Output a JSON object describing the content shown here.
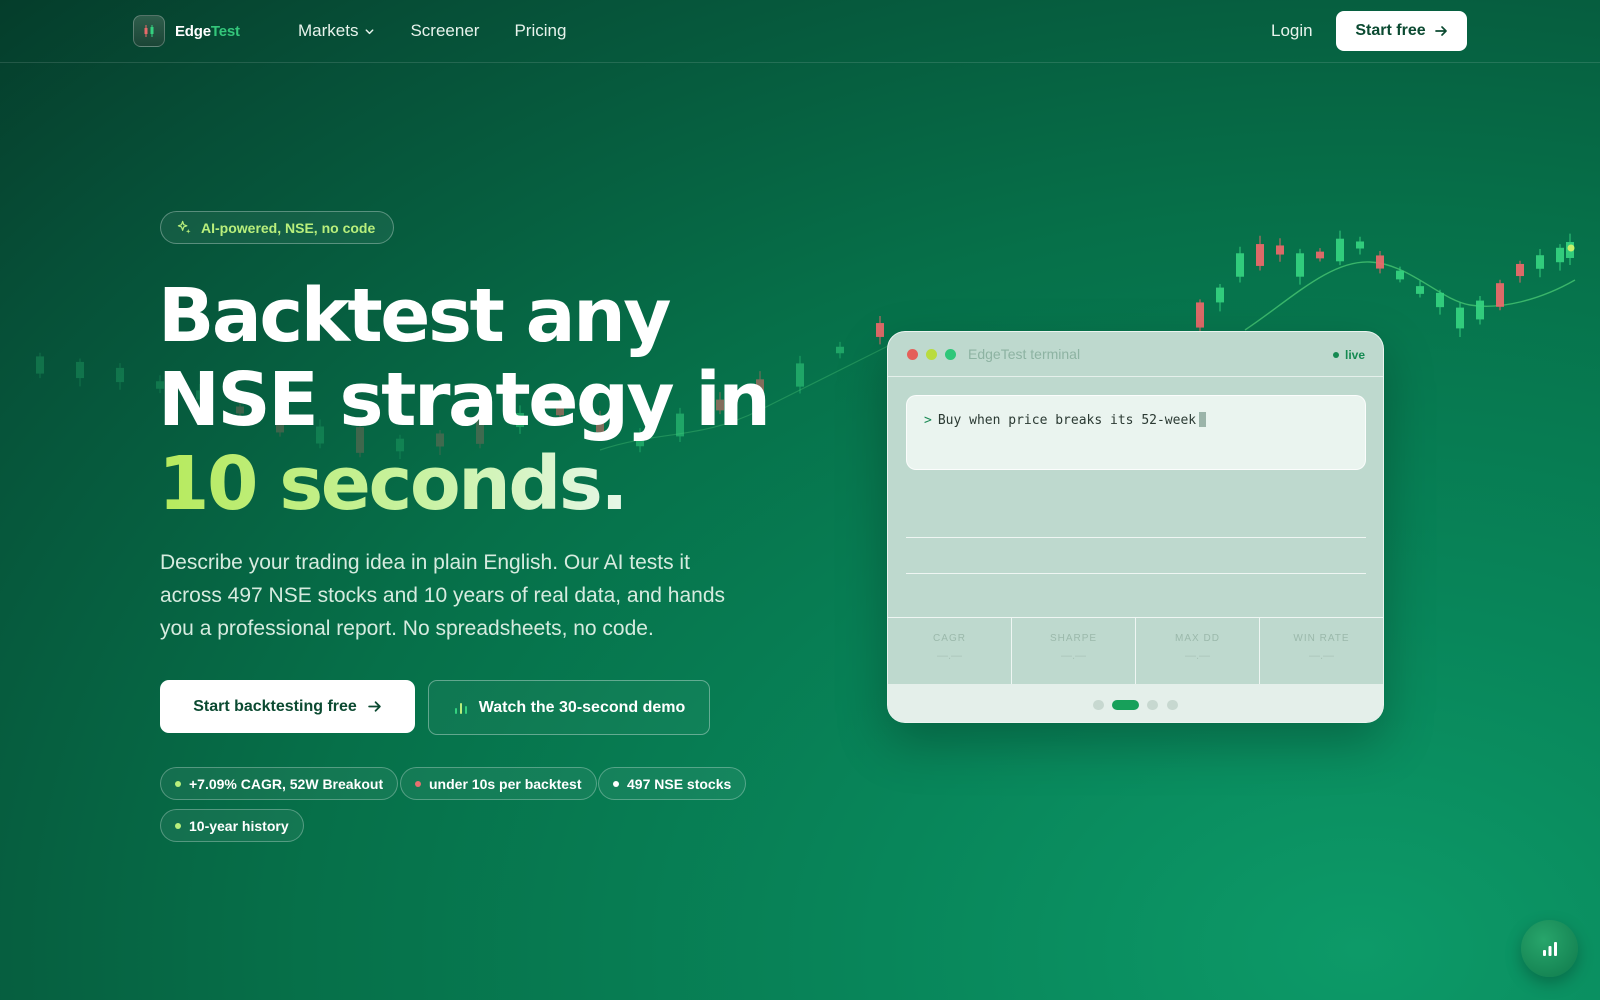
{
  "nav": {
    "logo_part1": "Edge",
    "logo_part2": "Test",
    "links": [
      "Markets",
      "Screener",
      "Pricing"
    ],
    "login": "Login",
    "start_free": "Start free"
  },
  "hero": {
    "badge": "AI-powered, NSE, no code",
    "headline_line1": "Backtest any",
    "headline_line2": "NSE strategy in",
    "headline_highlight": "10 seconds.",
    "subtext": "Describe your trading idea in plain English. Our AI tests it across 497 NSE stocks and 10 years of real data, and hands you a professional report. No spreadsheets, no code.",
    "cta_primary": "Start backtesting free",
    "cta_secondary": "Watch the 30-second demo",
    "chips": [
      {
        "label": "+7.09% CAGR, 52W Breakout",
        "dot_color": "#b9ef7c"
      },
      {
        "label": "under 10s per backtest",
        "dot_color": "#e87070"
      },
      {
        "label": "497 NSE stocks",
        "dot_color": "#ffffff"
      },
      {
        "label": "10-year history",
        "dot_color": "#b9ef7c"
      }
    ]
  },
  "terminal": {
    "title": "EdgeTest terminal",
    "status": "live",
    "prompt_symbol": ">",
    "prompt_text": "Buy when price breaks its 52-week",
    "metrics": [
      {
        "label": "CAGR",
        "value": "—.—"
      },
      {
        "label": "SHARPE",
        "value": "—.—"
      },
      {
        "label": "MAX DD",
        "value": "—.—"
      },
      {
        "label": "WIN RATE",
        "value": "—.—"
      }
    ],
    "active_page": 2,
    "page_count": 4
  },
  "colors": {
    "accent_lime": "#b9ef7c",
    "brand_green": "#34c77b",
    "candle_up": "#34d17f",
    "candle_down": "#e86a6a"
  },
  "icons": {
    "logo": "candlestick-icon",
    "badge": "sparkle-icon",
    "cta_primary": "arrow-right-icon",
    "cta_secondary": "bar-chart-icon",
    "float_button": "bar-chart-icon"
  }
}
